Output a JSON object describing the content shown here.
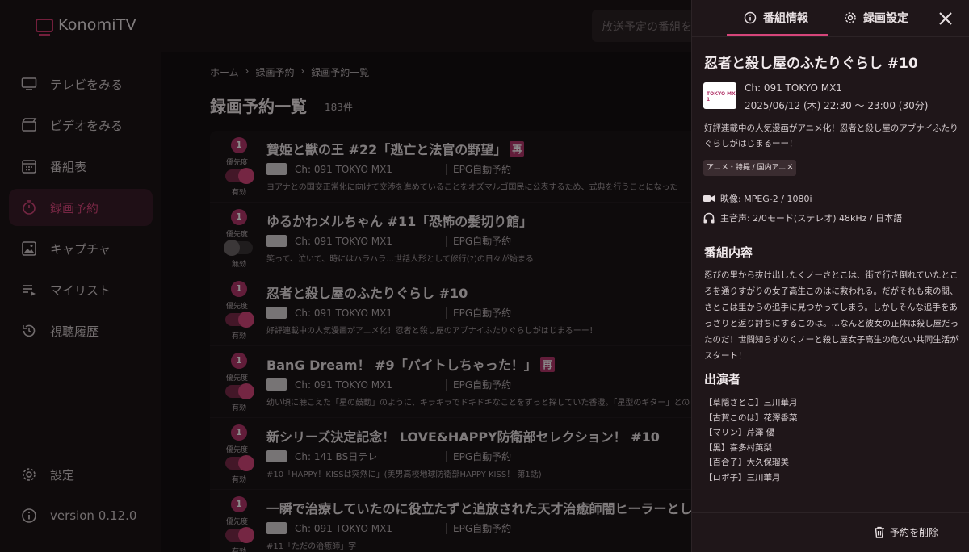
{
  "app": {
    "name": "KonomiTV"
  },
  "search": {
    "placeholder": "放送予定の番組を検索"
  },
  "sidebar": {
    "items": [
      {
        "label": "テレビをみる",
        "icon": "tv-icon"
      },
      {
        "label": "ビデオをみる",
        "icon": "video-icon"
      },
      {
        "label": "番組表",
        "icon": "calendar-icon"
      },
      {
        "label": "録画予約",
        "icon": "timer-icon",
        "active": true
      },
      {
        "label": "キャプチャ",
        "icon": "image-icon"
      },
      {
        "label": "マイリスト",
        "icon": "playlist-icon"
      },
      {
        "label": "視聴履歴",
        "icon": "history-icon"
      }
    ],
    "settings_label": "設定",
    "version_label": "version 0.12.0"
  },
  "breadcrumb": [
    "ホーム",
    "録画予約",
    "録画予約一覧"
  ],
  "page": {
    "title": "録画予約一覧",
    "count": "183件"
  },
  "list": {
    "priority_label": "優先度",
    "enabled_label": "有効",
    "disabled_label": "無効",
    "rows": [
      {
        "priority": "1",
        "enabled": true,
        "title": "贄姫と獣の王 #22「逃亡と法官の野望」",
        "badge": "再",
        "channel": "Ch: 091 TOKYO MX1",
        "mode": "EPG自動予約",
        "desc": "ヨアナとの国交正常化に向けて交渉を進めていることをオズマルゴ国民に公表するため、式典を行うことになった"
      },
      {
        "priority": "1",
        "enabled": false,
        "title": "ゆるかわメルちゃん #11「恐怖の髪切り館」",
        "badge": "",
        "channel": "Ch: 091 TOKYO MX1",
        "mode": "EPG自動予約",
        "desc": "笑って、泣いて、時にはハラハラ…世話人形として修行(?)の日々が始まる"
      },
      {
        "priority": "1",
        "enabled": true,
        "title": "忍者と殺し屋のふたりぐらし #10",
        "badge": "",
        "channel": "Ch: 091 TOKYO MX1",
        "mode": "EPG自動予約",
        "desc": "好評連載中の人気漫画がアニメ化！忍者と殺し屋のアブナイふたりぐらしがはじまるーー！"
      },
      {
        "priority": "1",
        "enabled": true,
        "title": "BanG Dream！ #9「バイトしちゃった！」",
        "badge": "再",
        "channel": "Ch: 091 TOKYO MX1",
        "mode": "EPG自動予約",
        "desc": "幼い頃に聴こえた「星の鼓動」のように、キラキラでドキドキなことをずっと探していた香澄。「星型のギター」との"
      },
      {
        "priority": "1",
        "enabled": true,
        "title": "新シリーズ決定記念！ LOVE&HAPPY防衛部セレクション！ #10",
        "badge": "",
        "channel": "Ch: 141 BS日テレ",
        "mode": "EPG自動予約",
        "desc": "#10「HAPPY！KISSは突然に」(美男高校地球防衛部HAPPY KISS！ 第1話)"
      },
      {
        "priority": "1",
        "enabled": true,
        "title": "一瞬で治療していたのに役立たずと追放された天才治癒師闇ヒーラーとし",
        "badge": "",
        "channel": "Ch: 091 TOKYO MX1",
        "mode": "EPG自動予約",
        "desc": "#11「ただの治癒師」字"
      }
    ]
  },
  "panel": {
    "tab_info": "番組情報",
    "tab_settings": "録画設定",
    "title": "忍者と殺し屋のふたりぐらし #10",
    "channel": "Ch: 091  TOKYO MX1",
    "time": "2025/06/12 (木) 22:30 〜 23:00 (30分)",
    "channel_logo_text": "TOKYO MX 1",
    "description": "好評連載中の人気漫画がアニメ化！忍者と殺し屋のアブナイふたりぐらしがはじまるーー！",
    "genre": "アニメ・特撮 / 国内アニメ",
    "video": "映像: MPEG-2 / 1080i",
    "audio": "主音声: 2/0モード(ステレオ) 48kHz / 日本語",
    "detail_heading": "番組内容",
    "detail_body": "忍びの里から抜け出したくノーさとこは、街で行き倒れていたところを通りすがりの女子高生このはに救われる。だがそれも束の間、さとこは里からの追手に見つかってしまう。しかしそんな追手をあっさりと返り討ちにするこのは。…なんと彼女の正体は殺し屋だったのだ！世間知らずのくノーと殺し屋女子高生の危ない共同生活がスタート！",
    "cast_heading": "出演者",
    "cast": [
      "【草隠さとこ】三川華月",
      "【古賀このは】花澤香菜",
      "【マリン】芹澤 優",
      "【黒】喜多村英梨",
      "【百合子】大久保瑠美",
      "【ロボ子】三川華月"
    ],
    "delete_label": "予約を削除"
  },
  "colors": {
    "accent": "#d6457a",
    "panel_bg": "#1f1619",
    "main_bg": "#141012"
  }
}
